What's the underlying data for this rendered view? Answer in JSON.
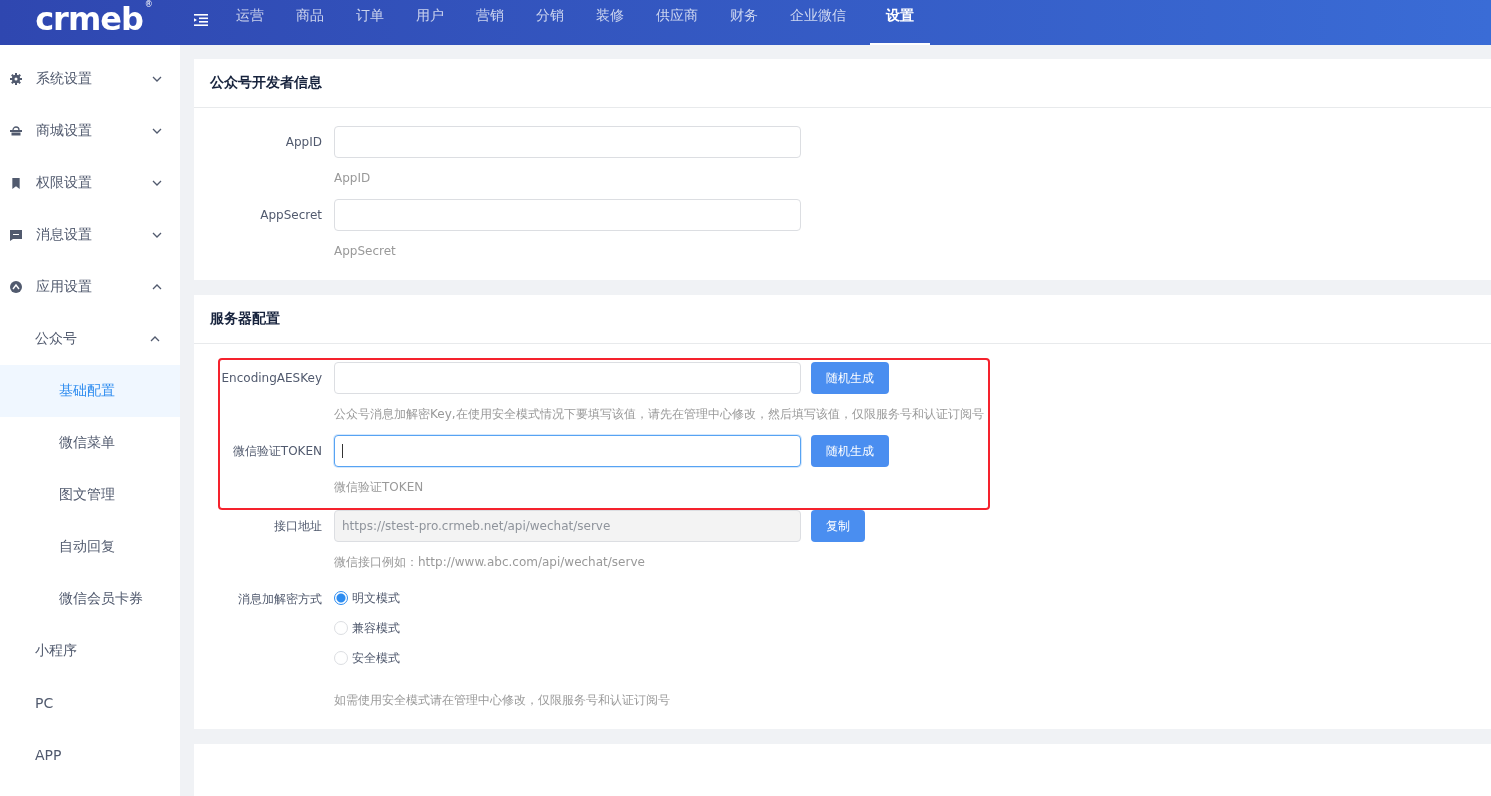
{
  "topbar": {
    "logo": "crmeb",
    "logo_mark": "®",
    "nav": [
      {
        "label": "运营",
        "selected": false
      },
      {
        "label": "商品",
        "selected": false
      },
      {
        "label": "订单",
        "selected": false
      },
      {
        "label": "用户",
        "selected": false
      },
      {
        "label": "营销",
        "selected": false
      },
      {
        "label": "分销",
        "selected": false
      },
      {
        "label": "装修",
        "selected": false
      },
      {
        "label": "供应商",
        "selected": false
      },
      {
        "label": "财务",
        "selected": false
      },
      {
        "label": "企业微信",
        "selected": false
      },
      {
        "label": "设置",
        "selected": true
      }
    ]
  },
  "sidebar": {
    "items": [
      {
        "label": "系统设置",
        "expanded": false
      },
      {
        "label": "商城设置",
        "expanded": false
      },
      {
        "label": "权限设置",
        "expanded": false
      },
      {
        "label": "消息设置",
        "expanded": false
      },
      {
        "label": "应用设置",
        "expanded": true,
        "children": [
          {
            "label": "公众号",
            "expanded": true,
            "children": [
              {
                "label": "基础配置",
                "selected": true
              },
              {
                "label": "微信菜单",
                "selected": false
              },
              {
                "label": "图文管理",
                "selected": false
              },
              {
                "label": "自动回复",
                "selected": false
              },
              {
                "label": "微信会员卡券",
                "selected": false
              }
            ]
          },
          {
            "label": "小程序"
          },
          {
            "label": "PC"
          },
          {
            "label": "APP"
          }
        ]
      }
    ]
  },
  "sections": [
    {
      "title": "公众号开发者信息",
      "fields": [
        {
          "kind": "text",
          "label": "AppID",
          "help": "AppID",
          "focused": false,
          "disabled": false,
          "highlighted": false
        },
        {
          "kind": "text",
          "label": "AppSecret",
          "help": "AppSecret",
          "focused": false,
          "disabled": false,
          "highlighted": false
        }
      ]
    },
    {
      "title": "服务器配置",
      "fields": [
        {
          "kind": "text",
          "label": "EncodingAESKey",
          "button": "随机生成",
          "help": "公众号消息加解密Key,在使用安全模式情况下要填写该值，请先在管理中心修改，然后填写该值，仅限服务号和认证订阅号",
          "focused": false,
          "disabled": false,
          "highlighted": true
        },
        {
          "kind": "text",
          "label": "微信验证TOKEN",
          "button": "随机生成",
          "help": "微信验证TOKEN",
          "focused": true,
          "disabled": false,
          "highlighted": true
        },
        {
          "kind": "text",
          "label": "接口地址",
          "value": "https://stest-pro.crmeb.net/api/wechat/serve",
          "button": "复制",
          "help": "微信接口例如：http://www.abc.com/api/wechat/serve",
          "focused": false,
          "disabled": true,
          "highlighted": false
        },
        {
          "kind": "radio",
          "label": "消息加解密方式",
          "options": [
            {
              "label": "明文模式",
              "selected": true
            },
            {
              "label": "兼容模式",
              "selected": false
            },
            {
              "label": "安全模式",
              "selected": false
            }
          ],
          "help": "如需使用安全模式请在管理中心修改，仅限服务号和认证订阅号",
          "highlighted": false
        }
      ]
    }
  ]
}
